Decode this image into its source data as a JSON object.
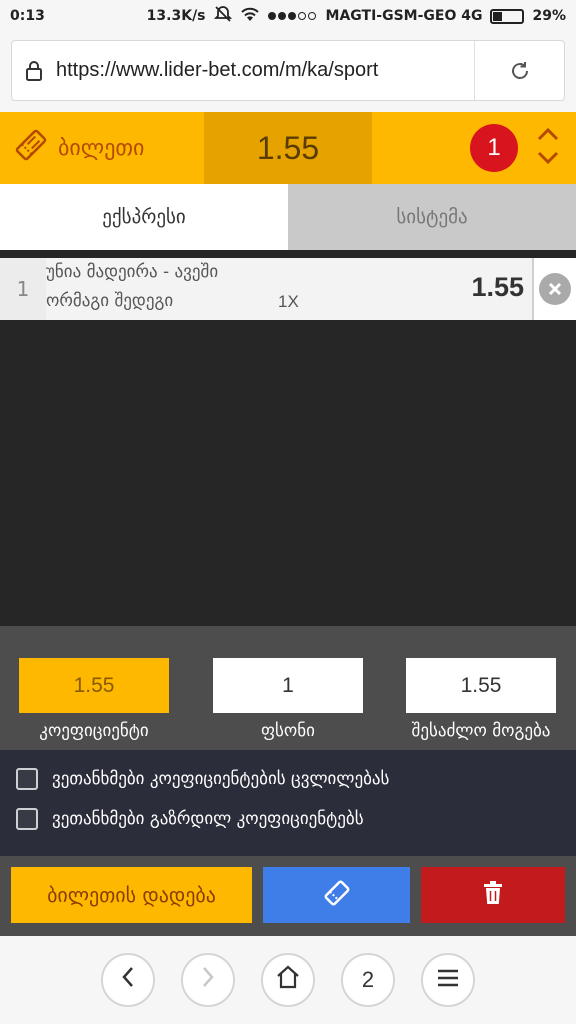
{
  "status_bar": {
    "time": "0:13",
    "speed": "13.3K/s",
    "carrier": "MAGTI-GSM-GEO 4G",
    "battery": "29%",
    "battery_level": 0.29
  },
  "browser": {
    "url": "https://www.lider-bet.com/m/ka/sport",
    "tab_count": "2"
  },
  "ticket": {
    "title": "ბილეთი",
    "total_odds": "1.55",
    "bet_count": "1"
  },
  "tabs": [
    {
      "label": "ექსპრესი",
      "active": true
    },
    {
      "label": "სისტემა",
      "active": false
    }
  ],
  "bets": [
    {
      "index": "1",
      "match": "უნია მადეირა - ავეში",
      "market": "ორმაგი შედეგი",
      "pick": "1X",
      "odds": "1.55"
    }
  ],
  "summary": {
    "coefficient_value": "1.55",
    "coefficient_label": "კოეფიციენტი",
    "stake_value": "1",
    "stake_label": "ფსონი",
    "win_value": "1.55",
    "win_label": "შესაძლო მოგება"
  },
  "options": {
    "accept_changes": "ვეთანხმები კოეფიციენტების ცვლილებას",
    "accept_increased": "ვეთანხმები გაზრდილ კოეფიციენტებს"
  },
  "actions": {
    "place_bet": "ბილეთის დადება"
  },
  "colors": {
    "accent_yellow": "#ffb800",
    "danger_red": "#c31a1e",
    "action_blue": "#3f7ee8"
  },
  "icons": {
    "ticket": "ticket-icon",
    "expand": "chevron-up-down-icon",
    "remove": "close-icon",
    "delete": "trash-icon"
  }
}
